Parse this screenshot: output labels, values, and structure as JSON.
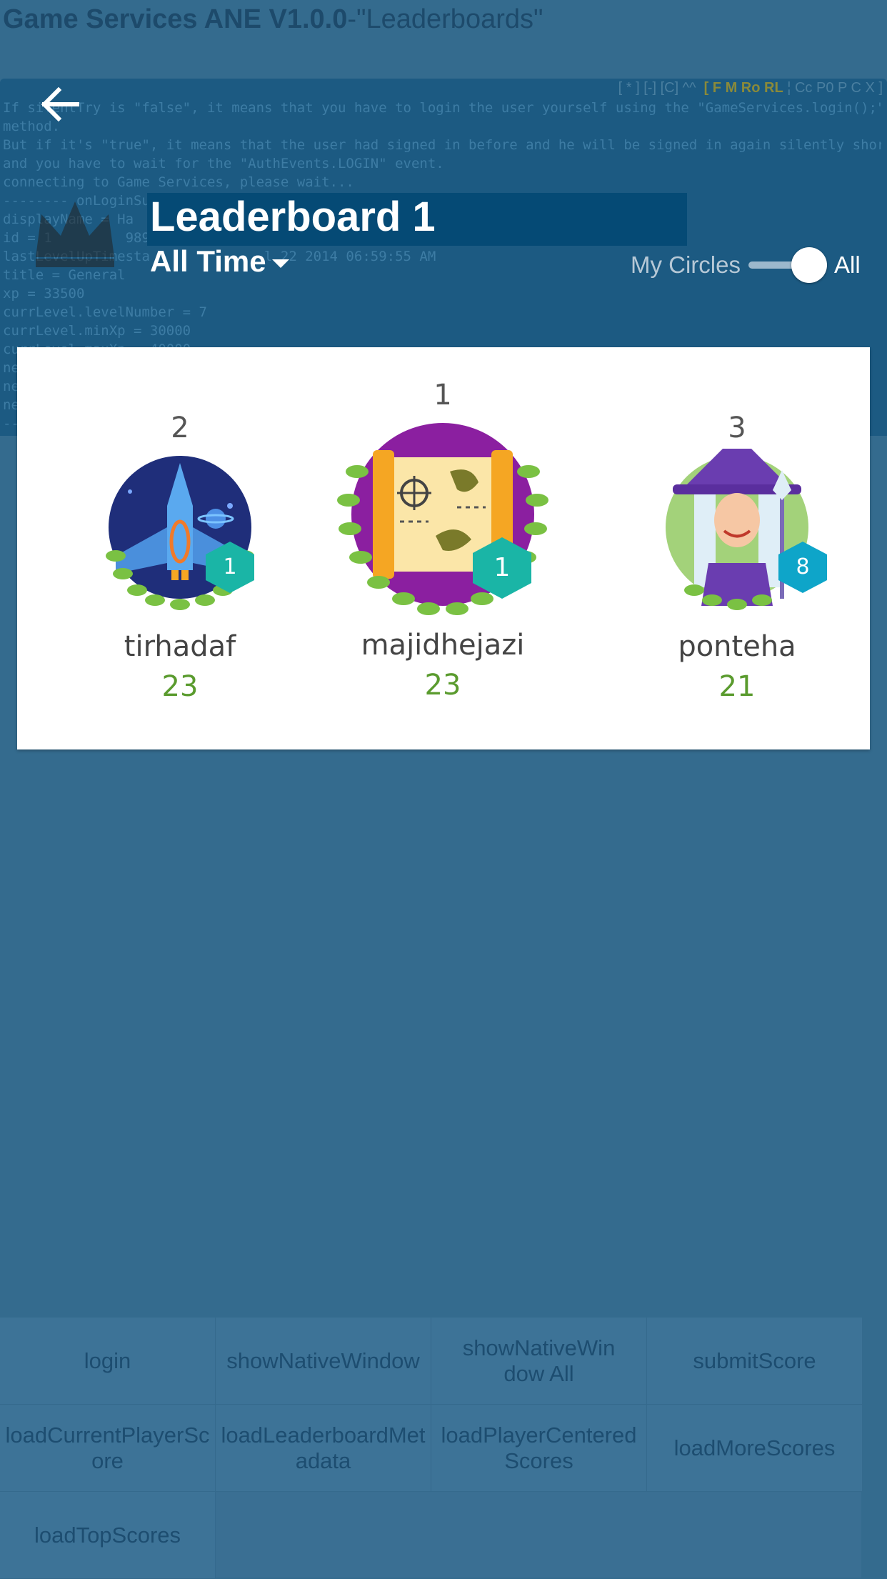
{
  "app": {
    "title_bold": "Game Services ANE V1.0.0",
    "title_rest": "-\"Leaderboards\""
  },
  "debug": {
    "bar": "[ * ] [-] [C] ^^",
    "bar_bold": "[ F M Ro RL",
    "bar_rest": "¦ Cc P0 P C X ]",
    "log": "If silentTry is \"false\", it means that you have to login the user yourself using the \"GameServices.login();\"\nmethod.\nBut if it's \"true\", it means that the user had signed in before and he will be signed in again silently shortly.\nand you have to wait for the \"AuthEvents.LOGIN\" event.\nconnecting to Game Services, please wait...\n-------- onLoginSu\ndisplayName = Ha\nid = 1         9896\nlastLevelUpTimesta              l 22 2014 06:59:55 AM\ntitle = General\nxp = 33500\ncurrLevel.levelNumber = 7\ncurrLevel.minXp = 30000\ncurrLevel.maxXp = 40000\nne\nne\nne\n--"
  },
  "leaderboard": {
    "title": "Leaderboard 1",
    "time_filter": "All Time",
    "toggle_left": "My Circles",
    "toggle_right": "All"
  },
  "players": [
    {
      "rank": "2",
      "name": "tirhadaf",
      "score": "23",
      "level": "1"
    },
    {
      "rank": "1",
      "name": "majidhejazi",
      "score": "23",
      "level": "1"
    },
    {
      "rank": "3",
      "name": "ponteha",
      "score": "21",
      "level": "8"
    }
  ],
  "buttons": [
    "login",
    "showNativeWindow",
    "showNativeWindow All",
    "submitScore",
    "loadCurrentPlayerScore",
    "loadLeaderboardMetadata",
    "loadPlayerCenteredScores",
    "loadMoreScores",
    "loadTopScores"
  ],
  "colors": {
    "score_green": "#5a9b2e",
    "level_teal": "#1ab5a6",
    "background": "#346b8e"
  }
}
